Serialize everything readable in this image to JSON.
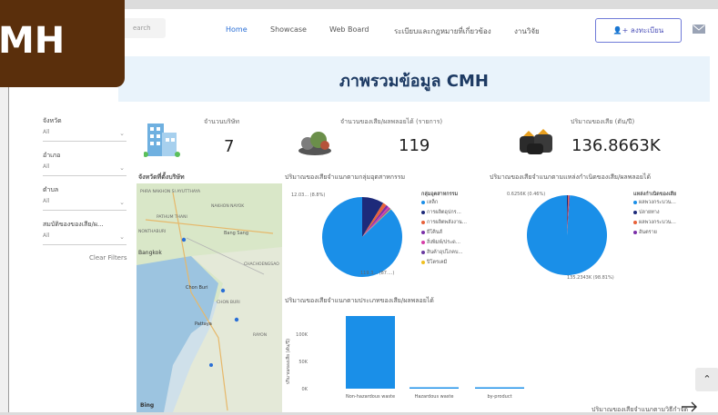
{
  "brand": {
    "text": "MH"
  },
  "nav": {
    "search_placeholder": "earch",
    "items": [
      "Home",
      "Showcase",
      "Web Board",
      "ระเบียบและกฎหมายที่เกี่ยวข้อง",
      "งานวิจัย"
    ],
    "register_label": "ลงทะเบียน"
  },
  "header": {
    "title": "ภาพรวมข้อมูล CMH"
  },
  "filters": {
    "items": [
      {
        "label": "จังหวัด",
        "value": "All"
      },
      {
        "label": "อำเภอ",
        "value": "All"
      },
      {
        "label": "ตำบล",
        "value": "All"
      },
      {
        "label": "สมบัติของของเสีย/ผ...",
        "value": "All"
      }
    ],
    "clear_label": "Clear Filters"
  },
  "kpis": [
    {
      "label": "จำนวนบริษัท",
      "value": "7"
    },
    {
      "label": "จำนวนของเสีย/ผลพลอยได้ (รายการ)",
      "value": "119"
    },
    {
      "label": "ปริมาณของเสีย (ตัน/ปี)",
      "value": "136.8663K"
    }
  ],
  "map": {
    "title": "จังหวัดที่ตั้งบริษัท",
    "places": [
      "PHRA NAKHON SI AYUTTHAYA",
      "NAKHON NAYOK",
      "PATHUM THANI",
      "NONTHABURI",
      "Bangkok",
      "Bang Sang",
      "CHACHOENGSAO",
      "Chon Buri",
      "Pattaya",
      "CHON BURI",
      "RAYON"
    ],
    "attribution": "Bing"
  },
  "charts": {
    "pie1": {
      "title": "ปริมาณของเสียจำแนกตามกลุ่มอุตสาหกรรม",
      "legend_title": "กลุ่มอุตสาหกรรม",
      "label_small": "12.03... (8.8%)",
      "label_big": "119.3... (87....)",
      "slices": [
        {
          "name": "เหล็ก",
          "color": "#1a8fe8",
          "pct": 87.2
        },
        {
          "name": "การผลิตอุปกร...",
          "color": "#1d2a7a",
          "pct": 8.8
        },
        {
          "name": "การผลิตพลังงาน...",
          "color": "#e8623a",
          "pct": 1.5
        },
        {
          "name": "ยีโคินส์",
          "color": "#7a2fa8",
          "pct": 1.0
        },
        {
          "name": "สิ่งพิมพ์/ประด...",
          "color": "#d63fa8",
          "pct": 0.8
        },
        {
          "name": "สินค้าอุปโภคบ...",
          "color": "#6a3aa0",
          "pct": 0.4
        },
        {
          "name": "ปิโตรเคมี",
          "color": "#f0c020",
          "pct": 0.3
        }
      ]
    },
    "pie2": {
      "title": "ปริมาณของเสียจำแนกตามแหล่งกำเนิดของเสีย/ผลพลอยได้",
      "legend_title": "แหล่งกำเนิดของเสีย",
      "label_small": "0.6256K (0.46%)",
      "label_big": "135.2343K (98.81%)",
      "slices": [
        {
          "name": "ผลพวงกระบวน...",
          "color": "#1a8fe8",
          "pct": 98.81
        },
        {
          "name": "ปลายทาง",
          "color": "#1d2a7a",
          "pct": 0.46
        },
        {
          "name": "ผลพวงกระบวน...",
          "color": "#e8623a",
          "pct": 0.4
        },
        {
          "name": "อันตราย",
          "color": "#7a2fa8",
          "pct": 0.33
        }
      ]
    },
    "bar": {
      "title": "ปริมาณของเสียจำแนกตามประเภทของเสีย/ผลพลอยได้",
      "ylabel": "ปริมาณของเสีย (ตัน/ปี)",
      "categories": [
        "Non-hazardous waste",
        "Hazardous waste",
        "by-product"
      ],
      "values": [
        135000,
        1200,
        600
      ],
      "yticks": [
        "100K",
        "50K",
        "0K"
      ],
      "color": "#1a8fe8"
    },
    "footer_text": "ปริมาณของเสียจำแนกตามวิธีกำจัด"
  },
  "chart_data": [
    {
      "type": "pie",
      "title": "ปริมาณของเสียจำแนกตามกลุ่มอุตสาหกรรม",
      "categories": [
        "เหล็ก",
        "การผลิตอุปกร...",
        "การผลิตพลังงาน...",
        "ยีโคินส์",
        "สิ่งพิมพ์/ประด...",
        "สินค้าอุปโภคบ...",
        "ปิโตรเคมี"
      ],
      "values": [
        87.2,
        8.8,
        1.5,
        1.0,
        0.8,
        0.4,
        0.3
      ]
    },
    {
      "type": "pie",
      "title": "ปริมาณของเสียจำแนกตามแหล่งกำเนิดของเสีย/ผลพลอยได้",
      "categories": [
        "ผลพวงกระบวน...",
        "ปลายทาง",
        "ผลพวงกระบวน...",
        "อันตราย"
      ],
      "values": [
        98.81,
        0.46,
        0.4,
        0.33
      ]
    },
    {
      "type": "bar",
      "title": "ปริมาณของเสียจำแนกตามประเภทของเสีย/ผลพลอยได้",
      "categories": [
        "Non-hazardous waste",
        "Hazardous waste",
        "by-product"
      ],
      "values": [
        135000,
        1200,
        600
      ],
      "ylabel": "ปริมาณของเสีย (ตัน/ปี)",
      "ylim": [
        0,
        135000
      ]
    }
  ]
}
